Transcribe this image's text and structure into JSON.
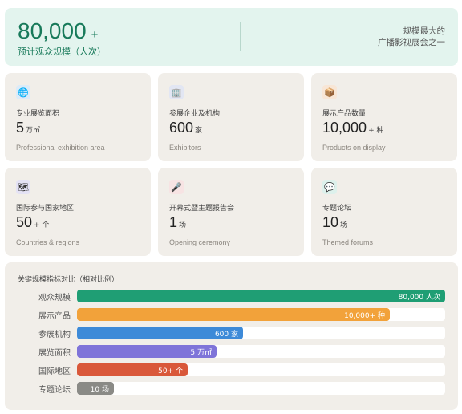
{
  "hero": {
    "number": "80,000",
    "plus": "+",
    "subtitle": "预计观众规模（人次）",
    "right_line1": "规模最大的",
    "right_line2": "广播影视展会之一"
  },
  "cards": [
    {
      "icon": "globe-icon",
      "glyph": "🌐",
      "icon_bg": "#dcebf8",
      "label": "专业展览面积",
      "value": "5",
      "unit": "万㎡",
      "en": "Professional exhibition area"
    },
    {
      "icon": "building-icon",
      "glyph": "🏢",
      "icon_bg": "#e2e6f3",
      "label": "参展企业及机构",
      "value": "600",
      "unit": "家",
      "en": "Exhibitors"
    },
    {
      "icon": "package-icon",
      "glyph": "📦",
      "icon_bg": "#f8e6d6",
      "label": "展示产品数量",
      "value": "10,000",
      "unit": "+ 种",
      "en": "Products on display"
    },
    {
      "icon": "map-icon",
      "glyph": "🗺",
      "icon_bg": "#e4e2f5",
      "label": "国际参与国家地区",
      "value": "50",
      "unit": "+ 个",
      "en": "Countries & regions"
    },
    {
      "icon": "podium-icon",
      "glyph": "🎤",
      "icon_bg": "#f7e3e3",
      "label": "开幕式暨主题报告会",
      "value": "1",
      "unit": "场",
      "en": "Opening ceremony"
    },
    {
      "icon": "speech-bubble-icon",
      "glyph": "💬",
      "icon_bg": "#ddf1ec",
      "label": "专题论坛",
      "value": "10",
      "unit": "场",
      "en": "Themed forums"
    }
  ],
  "chart_data": {
    "type": "bar",
    "title": "关键规模指标对比（相对比例）",
    "orientation": "horizontal",
    "categories": [
      "观众规模",
      "展示产品",
      "参展机构",
      "展览面积",
      "国际地区",
      "专题论坛"
    ],
    "values": [
      1.0,
      0.85,
      0.45,
      0.38,
      0.3,
      0.1
    ],
    "bar_labels": [
      "80,000 人次",
      "10,000+ 种",
      "600 家",
      "5 万㎡",
      "50+ 个",
      "10 场"
    ],
    "colors": [
      "#1f9e74",
      "#f2a23a",
      "#3d8ad8",
      "#7f74d9",
      "#d9583a",
      "#8a8a86"
    ],
    "xlim": [
      0,
      1
    ]
  }
}
